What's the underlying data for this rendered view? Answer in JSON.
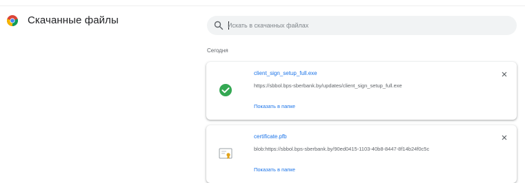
{
  "header": {
    "title": "Скачанные файлы"
  },
  "search": {
    "placeholder": "Искать в скачанных файлах"
  },
  "sections": [
    {
      "label": "Сегодня",
      "items": [
        {
          "file_name": "client_sign_setup_full.exe",
          "url": "https://sbbol.bps-sberbank.by/updates/client_sign_setup_full.exe",
          "action_label": "Показать в папке",
          "icon": "check-circle-icon",
          "status_color": "#34a853"
        },
        {
          "file_name": "certificate.pfb",
          "url": "blob:https://sbbol.bps-sberbank.by/90ed0415-1103-40b8-8447-8f14b24f0c5c",
          "action_label": "Показать в папке",
          "icon": "certificate-file-icon",
          "status_color": "#e2a31b"
        }
      ]
    }
  ],
  "colors": {
    "link": "#1a73e8",
    "accent_green": "#34a853",
    "search_bg": "#f1f3f4"
  }
}
